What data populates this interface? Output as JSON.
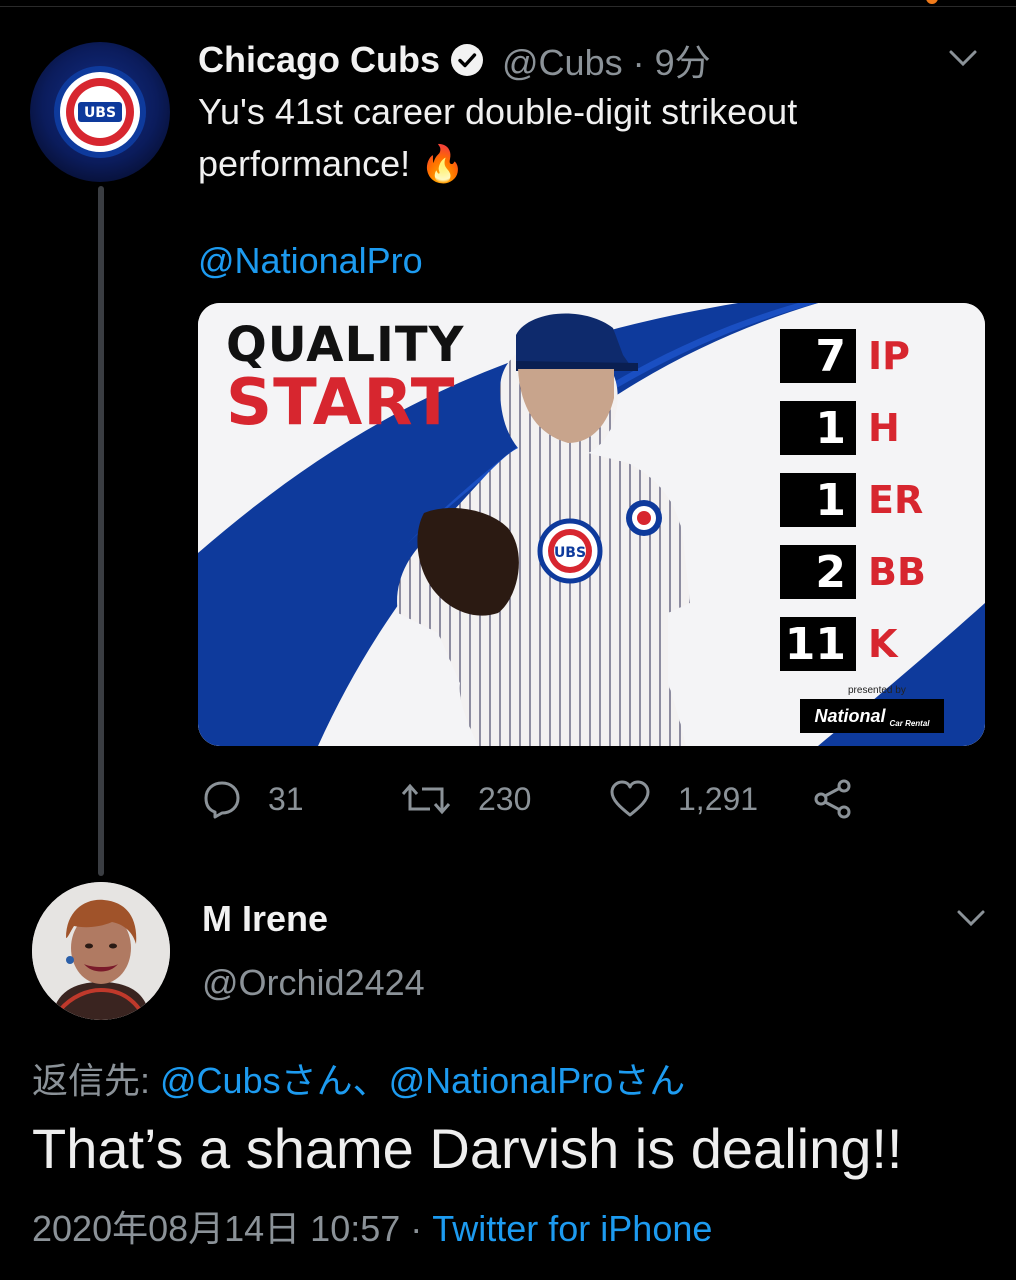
{
  "parent_tweet": {
    "author_name": "Chicago Cubs",
    "handle": "@Cubs",
    "separator": "·",
    "time": "9分",
    "text_line1": "Yu's 41st career double-digit strikeout",
    "text_line2": "performance! 🔥",
    "mention": "@NationalPro",
    "avatar_icon": "cubs-logo-icon",
    "graphic": {
      "title_line1": "QUALITY",
      "title_line2": "START",
      "stats": [
        {
          "value": "7",
          "label": "IP"
        },
        {
          "value": "1",
          "label": "H"
        },
        {
          "value": "1",
          "label": "ER"
        },
        {
          "value": "2",
          "label": "BB"
        },
        {
          "value": "11",
          "label": "K"
        }
      ],
      "presented_by": "presented by",
      "sponsor": "National",
      "sponsor_sub": "Car Rental",
      "logo_text": "UBS",
      "colors": {
        "blue": "#0e3a9c",
        "red": "#d7262f"
      }
    },
    "actions": {
      "replies": "31",
      "retweets": "230",
      "likes": "1,291"
    }
  },
  "reply_tweet": {
    "author_name": "M Irene",
    "handle": "@Orchid2424",
    "reply_prefix": "返信先: ",
    "reply_mentions": "@Cubsさん、@NationalProさん",
    "text": "That’s a shame Darvish is dealing!!",
    "timestamp": "2020年08月14日 10:57",
    "separator": " · ",
    "source": "Twitter for iPhone"
  },
  "theme": {
    "background": "#000000",
    "link": "#1d9bf0",
    "muted": "#8b9298",
    "thread_line": "#3a3d42"
  }
}
